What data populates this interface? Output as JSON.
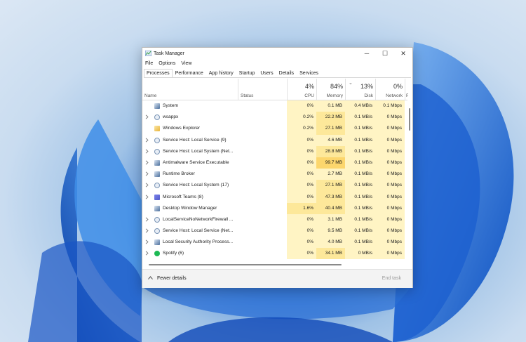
{
  "window": {
    "title": "Task Manager",
    "controls": {
      "minimize": "─",
      "maximize": "☐",
      "close": "✕"
    }
  },
  "menu": [
    "File",
    "Options",
    "View"
  ],
  "tabs": [
    "Processes",
    "Performance",
    "App history",
    "Startup",
    "Users",
    "Details",
    "Services"
  ],
  "active_tab": "Processes",
  "columns": {
    "name": "Name",
    "status": "Status",
    "cpu": {
      "pct": "4%",
      "label": "CPU"
    },
    "memory": {
      "pct": "84%",
      "label": "Memory"
    },
    "disk": {
      "pct": "13%",
      "label": "Disk"
    },
    "network": {
      "pct": "0%",
      "label": "Network"
    },
    "power": "Po",
    "sort_indicator": "⌄"
  },
  "processes": [
    {
      "name": "System",
      "expand": false,
      "icon": "system-icon",
      "cpu": "0%",
      "memory": "0.1 MB",
      "disk": "0.4 MB/s",
      "network": "0.1 Mbps"
    },
    {
      "name": "wsappx",
      "expand": true,
      "icon": "gear-icon",
      "cpu": "0.2%",
      "memory": "22.2 MB",
      "disk": "0.1 MB/s",
      "network": "0 Mbps"
    },
    {
      "name": "Windows Explorer",
      "expand": false,
      "icon": "folder-icon",
      "cpu": "0.2%",
      "memory": "27.1 MB",
      "disk": "0.1 MB/s",
      "network": "0 Mbps"
    },
    {
      "name": "Service Host: Local Service (9)",
      "expand": true,
      "icon": "gear-icon",
      "cpu": "0%",
      "memory": "4.6 MB",
      "disk": "0.1 MB/s",
      "network": "0 Mbps"
    },
    {
      "name": "Service Host: Local System (Net...",
      "expand": true,
      "icon": "gear-icon",
      "cpu": "0%",
      "memory": "28.8 MB",
      "disk": "0.1 MB/s",
      "network": "0 Mbps"
    },
    {
      "name": "Antimalware Service Executable",
      "expand": true,
      "icon": "system-icon",
      "cpu": "0%",
      "memory": "99.7 MB",
      "disk": "0.1 MB/s",
      "network": "0 Mbps"
    },
    {
      "name": "Runtime Broker",
      "expand": true,
      "icon": "system-icon",
      "cpu": "0%",
      "memory": "2.7 MB",
      "disk": "0.1 MB/s",
      "network": "0 Mbps"
    },
    {
      "name": "Service Host: Local System (17)",
      "expand": true,
      "icon": "gear-icon",
      "cpu": "0%",
      "memory": "27.1 MB",
      "disk": "0.1 MB/s",
      "network": "0 Mbps"
    },
    {
      "name": "Microsoft Teams (8)",
      "expand": true,
      "icon": "teams-icon",
      "cpu": "0%",
      "memory": "47.3 MB",
      "disk": "0.1 MB/s",
      "network": "0 Mbps"
    },
    {
      "name": "Desktop Window Manager",
      "expand": false,
      "icon": "system-icon",
      "cpu": "1.6%",
      "memory": "40.4 MB",
      "disk": "0.1 MB/s",
      "network": "0 Mbps"
    },
    {
      "name": "LocalServiceNoNetworkFirewall ...",
      "expand": true,
      "icon": "gear-icon",
      "cpu": "0%",
      "memory": "3.1 MB",
      "disk": "0.1 MB/s",
      "network": "0 Mbps"
    },
    {
      "name": "Service Host: Local Service (Net...",
      "expand": true,
      "icon": "gear-icon",
      "cpu": "0%",
      "memory": "9.5 MB",
      "disk": "0.1 MB/s",
      "network": "0 Mbps"
    },
    {
      "name": "Local Security Authority Process...",
      "expand": true,
      "icon": "system-icon",
      "cpu": "0%",
      "memory": "4.0 MB",
      "disk": "0.1 MB/s",
      "network": "0 Mbps"
    },
    {
      "name": "Spotify (6)",
      "expand": true,
      "icon": "spotify-icon",
      "cpu": "0%",
      "memory": "34.1 MB",
      "disk": "0 MB/s",
      "network": "0 Mbps"
    }
  ],
  "footer": {
    "fewer_details": "Fewer details",
    "end_task": "End task"
  },
  "colors": {
    "heat_light": "#fff4c4",
    "heat_medium": "#fde89a",
    "heat_strong": "#fcd66d",
    "accent": "#0078d4"
  }
}
